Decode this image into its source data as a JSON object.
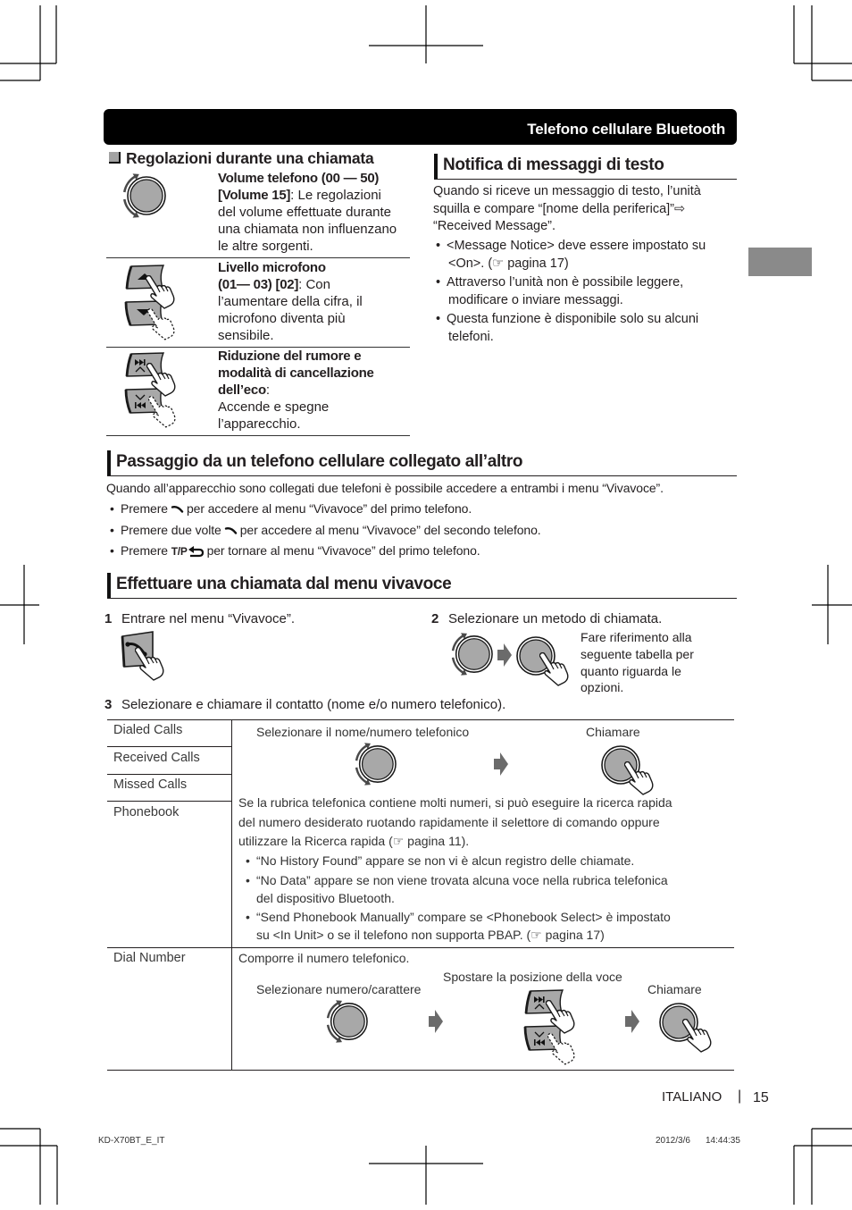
{
  "header": {
    "title": "Telefono cellulare Bluetooth"
  },
  "regolazioni": {
    "title": "Regolazioni durante una chiamata",
    "rows": [
      {
        "icon": "rotate-knob-icon",
        "lines": [
          {
            "bold": "Volume telefono (00 — 50)",
            "text": ""
          },
          {
            "bold": "[Volume 15]",
            "text": ": Le regolazioni"
          },
          {
            "bold": "",
            "text": "del volume effettuate durante"
          },
          {
            "bold": "",
            "text": "una chiamata non influenzano"
          },
          {
            "bold": "",
            "text": "le altre sorgenti."
          }
        ]
      },
      {
        "icon": "up-down-buttons-icon",
        "lines": [
          {
            "bold": "Livello microfono",
            "text": ""
          },
          {
            "bold": "(01— 03) [02]",
            "text": ": Con"
          },
          {
            "bold": "",
            "text": "l’aumentare della cifra, il"
          },
          {
            "bold": "",
            "text": "microfono diventa più"
          },
          {
            "bold": "",
            "text": "sensibile."
          }
        ]
      },
      {
        "icon": "seek-buttons-icon",
        "lines": [
          {
            "bold": "Riduzione del rumore e",
            "text": ""
          },
          {
            "bold": "modalità di cancellazione",
            "text": ""
          },
          {
            "bold": "dell’eco",
            "text": ":"
          },
          {
            "bold": "",
            "text": "Accende e spegne"
          },
          {
            "bold": "",
            "text": "l’apparecchio."
          }
        ]
      }
    ]
  },
  "notifica": {
    "title": "Notifica di messaggi di testo",
    "paragraph": [
      "Quando si riceve un messaggio di testo, l’unità",
      "squilla e compare “[nome della periferica]”⇨",
      "“Received Message”."
    ],
    "bullets": [
      [
        "<Message Notice> deve essere impostato su",
        "<On>. (☞ pagina 17)"
      ],
      [
        "Attraverso l’unità non è possibile leggere,",
        "modificare o inviare messaggi."
      ],
      [
        "Questa funzione è disponibile solo su alcuni",
        "telefoni."
      ]
    ]
  },
  "passaggio": {
    "title": "Passaggio da un telefono cellulare collegato all’altro",
    "paragraph": "Quando all’apparecchio sono collegati due telefoni è possibile accedere a entrambi i menu “Vivavoce”.",
    "bullets": [
      {
        "before": "Premere",
        "icon": "phone-icon",
        "after": "per accedere al menu “Vivavoce” del primo telefono."
      },
      {
        "before": "Premere due volte",
        "icon": "phone-icon",
        "after": "per accedere al menu “Vivavoce” del secondo telefono."
      },
      {
        "before": "Premere",
        "key_label": "T/P",
        "icon": "back-icon",
        "after": "per tornare al menu “Vivavoce” del primo telefono."
      }
    ]
  },
  "effettuare": {
    "title": "Effettuare una chiamata dal menu vivavoce",
    "steps": [
      {
        "num": "1",
        "text": "Entrare nel menu “Vivavoce”."
      },
      {
        "num": "2",
        "text": "Selezionare un metodo di chiamata.",
        "note": [
          "Fare riferimento alla",
          "seguente tabella per",
          "quanto riguarda le",
          "opzioni."
        ]
      },
      {
        "num": "3",
        "text": "Selezionare e chiamare il contatto (nome e/o numero telefonico)."
      }
    ]
  },
  "table": {
    "labels": [
      "Dialed Calls",
      "Received Calls",
      "Missed Calls",
      "Phonebook",
      "Dial Number"
    ],
    "calls": {
      "select_label": "Selezionare il nome/numero telefonico",
      "call_label": "Chiamare",
      "paragraph": [
        "Se la rubrica telefonica contiene molti numeri, si può eseguire la ricerca rapida",
        "del numero desiderato ruotando rapidamente il selettore di comando oppure",
        "utilizzare la Ricerca rapida (☞ pagina 11)."
      ],
      "bullets": [
        [
          "“No History Found” appare se non vi è alcun registro delle chiamate."
        ],
        [
          "“No Data” appare se non viene trovata alcuna voce nella rubrica telefonica",
          "del dispositivo Bluetooth."
        ],
        [
          "“Send Phonebook Manually” compare se <Phonebook Select> è impostato",
          "su <In Unit> o se il telefono non supporta PBAP. (☞ pagina 17)"
        ]
      ]
    },
    "dial": {
      "intro": "Comporre il numero telefonico.",
      "select_label": "Selezionare numero/carattere",
      "move_label": "Spostare la posizione della voce",
      "call_label": "Chiamare"
    }
  },
  "footer": {
    "language": "ITALIANO",
    "separator": "|",
    "page": "15"
  },
  "print_info": {
    "file": "KD-X70BT_E_IT",
    "date": "2012/3/6",
    "time": "14:44:35"
  },
  "colors": {
    "header_bg": "#000000",
    "side_tab": "#8a8a8a",
    "knob_fill": "#a8a8a8",
    "arrow": "#6b6b6b"
  }
}
